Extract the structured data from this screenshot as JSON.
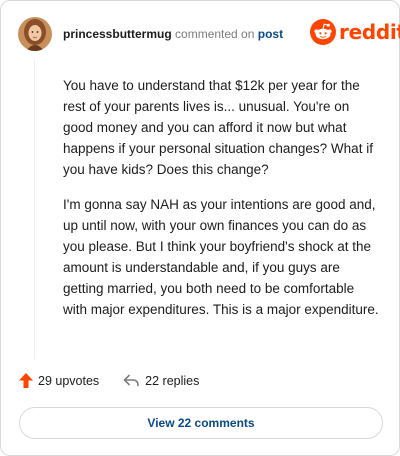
{
  "comment": {
    "author": "princessbuttermug",
    "action_text": "commented on",
    "post_link": "post",
    "paragraphs": [
      "You have to understand that $12k per year for the rest of your parents lives is... unusual. You're on good money and you can afford it now but what happens if your personal situation changes? What if you have kids? Does this change?",
      "I'm gonna say NAH as your intentions are good and, up until now, with your own finances you can do as you please. But I think your boyfriend's shock at the amount is understandable and, if you guys are getting married, you both need to be comfortable with major expenditures. This is a major expenditure."
    ]
  },
  "brand": {
    "wordmark": "reddit",
    "color": "#ff4500"
  },
  "stats": {
    "upvotes": "29 upvotes",
    "replies": "22 replies"
  },
  "footer": {
    "view_comments": "View 22 comments"
  },
  "icons": {
    "avatar": "user-avatar",
    "logo": "reddit-snoo-icon",
    "upvote": "upvote-arrow-icon",
    "reply": "reply-arrow-icon"
  }
}
